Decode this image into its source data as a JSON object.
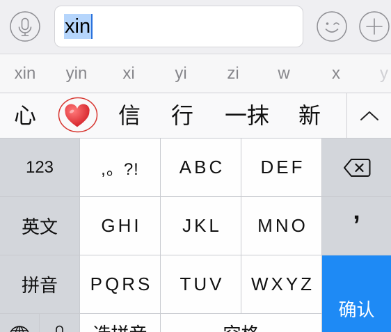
{
  "input_bar": {
    "voice_icon": "microphone-icon",
    "text": "xin",
    "emoji_icon": "smiley-face-icon",
    "more_icon": "plus-circle-icon"
  },
  "pinyin_candidates": [
    "xin",
    "yin",
    "xi",
    "yi",
    "zi",
    "w",
    "x",
    "y"
  ],
  "hanzi_candidates": [
    {
      "text": "心"
    },
    {
      "icon": "red-heart-emoji",
      "circled": true
    },
    {
      "text": "信"
    },
    {
      "text": "行"
    },
    {
      "text": "一抹"
    },
    {
      "text": "新"
    }
  ],
  "expand_icon": "chevron-up-icon",
  "keyboard": {
    "function_keys": {
      "numbers": "123",
      "english": "英文",
      "pinyin": "拼音"
    },
    "letter_keys": [
      [
        ",。?!",
        "ABC",
        "DEF"
      ],
      [
        "GHI",
        "JKL",
        "MNO"
      ],
      [
        "PQRS",
        "TUV",
        "WXYZ"
      ]
    ],
    "delete_icon": "backspace-icon",
    "separator_key": "’",
    "confirm": "确认",
    "bottom_row": {
      "globe_icon": "globe-icon",
      "voice_icon": "microphone-icon",
      "select_pinyin": "选拼音",
      "space": "空格"
    }
  },
  "colors": {
    "accent": "#1e8af5",
    "selection": "#b5d5fc",
    "caret": "#2a72dd",
    "annotation": "#d7352f",
    "heart": "#d01820"
  }
}
